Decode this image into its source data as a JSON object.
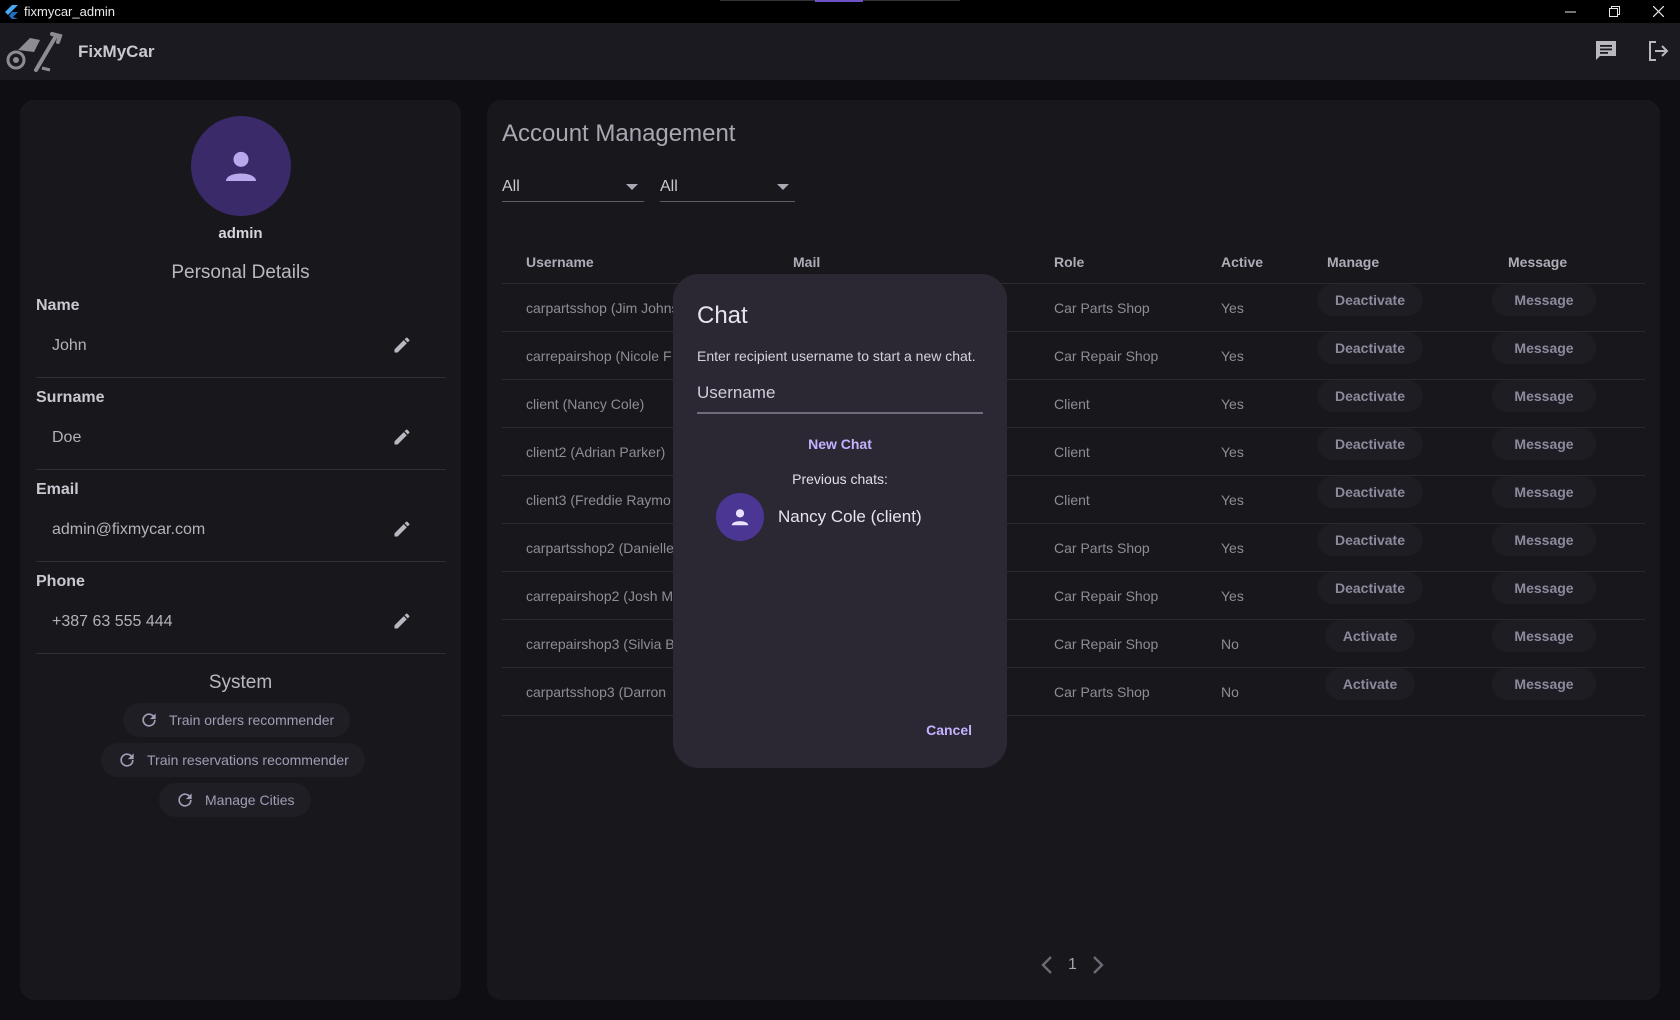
{
  "window": {
    "title": "fixmycar_admin",
    "controls": [
      "minimize",
      "restore",
      "close"
    ]
  },
  "appbar": {
    "name": "FixMyCar",
    "actions": [
      "chat-icon",
      "logout-icon"
    ]
  },
  "profile": {
    "username": "admin",
    "personal_title": "Personal Details",
    "fields": [
      {
        "label": "Name",
        "value": "John"
      },
      {
        "label": "Surname",
        "value": "Doe"
      },
      {
        "label": "Email",
        "value": "admin@fixmycar.com"
      },
      {
        "label": "Phone",
        "value": "+387 63 555 444"
      }
    ],
    "system_title": "System",
    "system_buttons": [
      "Train orders recommender",
      "Train reservations recommender",
      "Manage Cities"
    ]
  },
  "accounts": {
    "title": "Account Management",
    "filters": [
      {
        "value": "All"
      },
      {
        "value": "All"
      }
    ],
    "columns": [
      "Username",
      "Mail",
      "Role",
      "Active",
      "Manage",
      "Message"
    ],
    "rows": [
      {
        "username": "carpartsshop (Jim Johns",
        "role": "Car Parts Shop",
        "active": "Yes",
        "manage": "Deactivate",
        "message": "Message"
      },
      {
        "username": "carrepairshop (Nicole F",
        "role": "Car Repair Shop",
        "active": "Yes",
        "manage": "Deactivate",
        "message": "Message"
      },
      {
        "username": "client (Nancy Cole)",
        "role": "Client",
        "active": "Yes",
        "manage": "Deactivate",
        "message": "Message"
      },
      {
        "username": "client2 (Adrian Parker)",
        "role": "Client",
        "active": "Yes",
        "manage": "Deactivate",
        "message": "Message"
      },
      {
        "username": "client3 (Freddie Raymo",
        "role": "Client",
        "active": "Yes",
        "manage": "Deactivate",
        "message": "Message"
      },
      {
        "username": "carpartsshop2 (Danielle",
        "role": "Car Parts Shop",
        "active": "Yes",
        "manage": "Deactivate",
        "message": "Message"
      },
      {
        "username": "carrepairshop2 (Josh M",
        "role": "Car Repair Shop",
        "active": "Yes",
        "manage": "Deactivate",
        "message": "Message"
      },
      {
        "username": "carrepairshop3 (Silvia B",
        "role": "Car Repair Shop",
        "active": "No",
        "manage": "Activate",
        "message": "Message"
      },
      {
        "username": "carpartsshop3 (Darron",
        "role": "Car Parts Shop",
        "active": "No",
        "manage": "Activate",
        "message": "Message"
      }
    ],
    "page": "1"
  },
  "chat_dialog": {
    "title": "Chat",
    "subtitle": "Enter recipient username to start a new chat.",
    "input_placeholder": "Username",
    "input_value": "",
    "new_chat_label": "New Chat",
    "previous_label": "Previous chats:",
    "previous_chats": [
      "Nancy Cole (client)"
    ],
    "cancel_label": "Cancel"
  },
  "colors": {
    "accent": "#c4b1ff",
    "avatar": "#3a2a6a",
    "dialog": "#2b2833",
    "panel": "#18171c"
  }
}
